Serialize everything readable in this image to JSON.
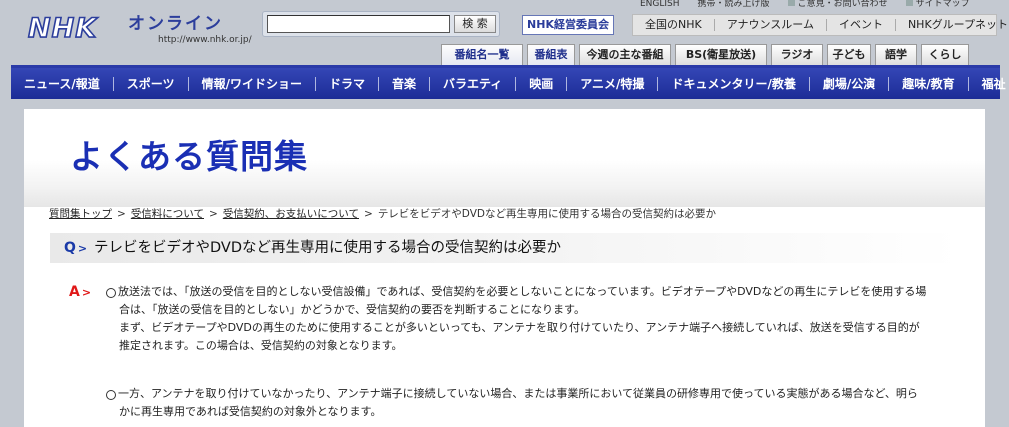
{
  "header": {
    "logo_text": "NHK",
    "logo_online": "オンライン",
    "logo_url": "http://www.nhk.or.jp/",
    "search_placeholder": "",
    "search_button": "検 索",
    "committee_link": "NHK経営委員会",
    "top_links": [
      "ENGLISH",
      "携帯・読み上げ版",
      "ご意見・お問い合わせ",
      "サイトマップ"
    ],
    "nhk_net_links": [
      "全国のNHK",
      "アナウンスルーム",
      "イベント",
      "NHKグループネット"
    ]
  },
  "tabs": [
    "番組名一覧",
    "番組表",
    "今週の主な番組",
    "BS(衛星放送)",
    "ラジオ",
    "子ども",
    "語学",
    "くらし"
  ],
  "genre_nav": [
    "ニュース/報道",
    "スポーツ",
    "情報/ワイドショー",
    "ドラマ",
    "音楽",
    "バラエティ",
    "映画",
    "アニメ/特撮",
    "ドキュメンタリー/教養",
    "劇場/公演",
    "趣味/教育",
    "福祉"
  ],
  "page": {
    "title": "よくある質問集",
    "breadcrumb": [
      "質問集トップ",
      "受信料について",
      "受信契約、お支払いについて",
      "テレビをビデオやDVDなど再生専用に使用する場合の受信契約は必要か"
    ],
    "question_mark": "Q",
    "question": "テレビをビデオやDVDなど再生専用に使用する場合の受信契約は必要か",
    "answer_mark": "A",
    "answer_1_lines": [
      "放送法では、「放送の受信を目的としない受信設備」であれば、受信契約を必要としないことになっています。ビデオテープやDVDなどの再生にテレビを使用する場",
      "合は、「放送の受信を目的としない」かどうかで、受信契約の要否を判断することになります。",
      "まず、ビデオテープやDVDの再生のために使用することが多いといっても、アンテナを取り付けていたり、アンテナ端子へ接続していれば、放送を受信する目的が",
      "推定されます。この場合は、受信契約の対象となります。"
    ],
    "answer_2_lines": [
      "一方、アンテナを取り付けていなかったり、アンテナ端子に接続していない場合、または事業所において従業員の研修専用で使っている実態がある場合など、明ら",
      "かに再生専用であれば受信契約の対象外となります。"
    ]
  },
  "colors": {
    "brand_blue": "#1a2fb4",
    "nav_blue": "#2535a6",
    "answer_red": "#e01818",
    "background": "#c4c9d1"
  }
}
